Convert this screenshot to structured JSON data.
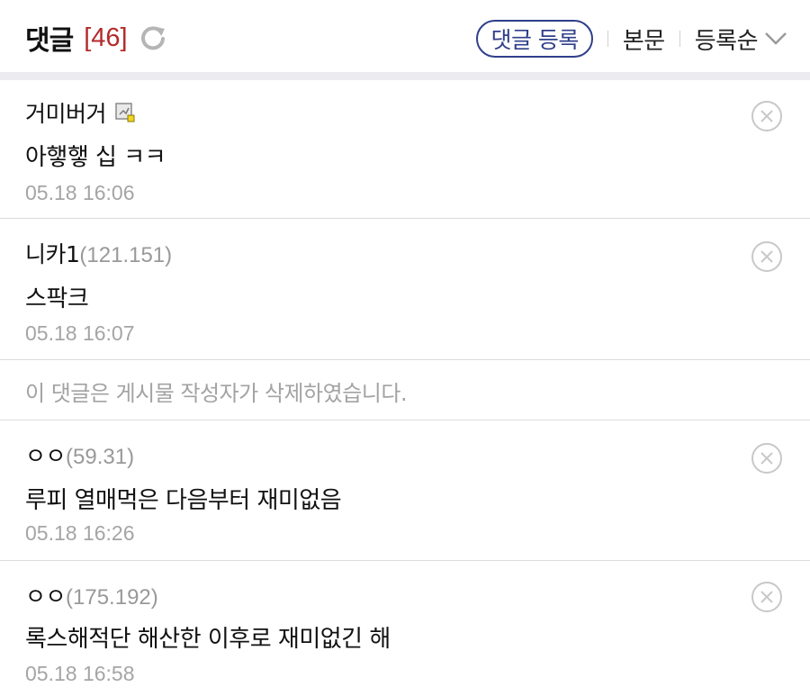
{
  "header": {
    "title": "댓글",
    "count": "[46]",
    "register_label": "댓글 등록",
    "body_link": "본문",
    "sort_label": "등록순"
  },
  "comments": [
    {
      "author": "거미버거",
      "ip": "",
      "body": "아햏햏 십 ㅋㅋ",
      "time": "05.18 16:06",
      "has_badge": true
    },
    {
      "author": "니카1",
      "ip": "(121.151)",
      "body": "스팍크",
      "time": "05.18 16:07"
    },
    {
      "deleted_text": "이 댓글은 게시물 작성자가 삭제하였습니다."
    },
    {
      "author": "ㅇㅇ",
      "ip": "(59.31)",
      "body": "루피 열매먹은 다음부터 재미없음",
      "time": "05.18 16:26"
    },
    {
      "author": "ㅇㅇ",
      "ip": "(175.192)",
      "body": "록스해적단 해산한 이후로 재미없긴 해",
      "time": "05.18 16:58"
    }
  ],
  "colors": {
    "count": "#b32b2b",
    "register_border": "#2f3f8a",
    "muted": "#a5a5a5"
  },
  "icons": {
    "refresh": "refresh-icon",
    "sort": "chevron-down-icon",
    "delete": "close-circle-icon",
    "badge": "gallery-badge-icon"
  }
}
